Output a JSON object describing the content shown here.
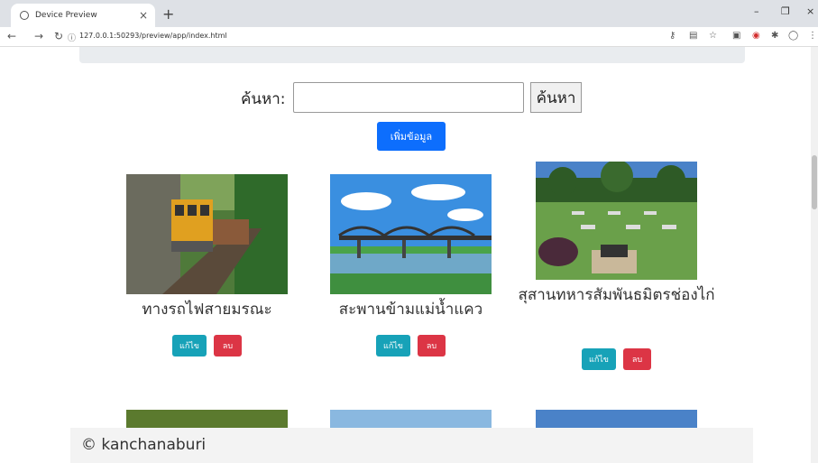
{
  "browser": {
    "tab_title": "Device Preview",
    "tab_close": "×",
    "new_tab": "+",
    "url": "127.0.0.1:50293/preview/app/index.html",
    "window_controls": [
      "–",
      "❐",
      "×"
    ]
  },
  "search": {
    "label": "ค้นหา:",
    "input_value": "",
    "button_label": "ค้นหา"
  },
  "add_button_label": "เพิ่มข้อมูล",
  "cards": [
    {
      "title": "ทางรถไฟสายมรณะ",
      "edit_label": "แก้ไข",
      "delete_label": "ลบ"
    },
    {
      "title": "สะพานข้ามแม่น้ำแคว",
      "edit_label": "แก้ไข",
      "delete_label": "ลบ"
    },
    {
      "title": "สุสานทหารสัมพันธมิตรช่องไก่",
      "edit_label": "แก้ไข",
      "delete_label": "ลบ"
    }
  ],
  "footer_text": "© kanchanaburi",
  "colors": {
    "primary": "#0d6efd",
    "edit": "#17a2b8",
    "delete": "#dc3545"
  }
}
